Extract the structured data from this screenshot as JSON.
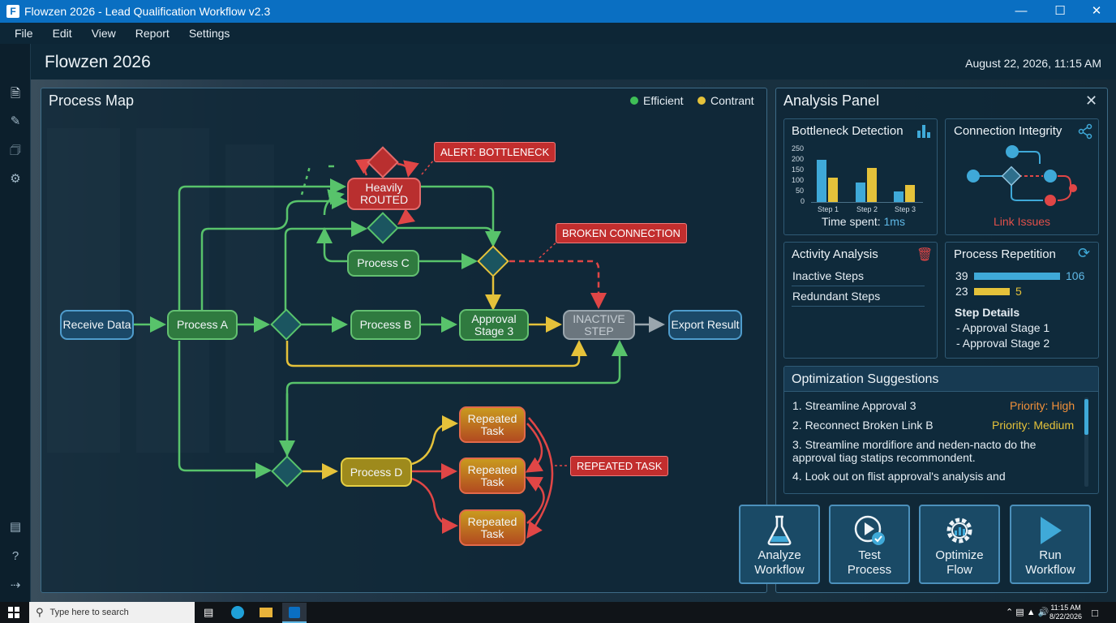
{
  "window": {
    "title": "Flowzen 2026 - Lead Qualification Workflow v2.3",
    "app_icon": "F"
  },
  "menu": [
    "File",
    "Edit",
    "View",
    "Report",
    "Settings"
  ],
  "header": {
    "title": "Flowzen 2026",
    "datetime": "August 22, 2026, 11:15 AM"
  },
  "process_map": {
    "title": "Process Map",
    "legend": [
      {
        "label": "Efficient",
        "color": "#3fbf57"
      },
      {
        "label": "Contrant",
        "color": "#e5c23a"
      }
    ],
    "nodes": {
      "receive": "Receive Data",
      "proc_a": "Process A",
      "proc_b": "Process B",
      "proc_c": "Process C",
      "proc_d": "Process D",
      "approval_1": "Approval",
      "approval_2": "Stage 3",
      "inactive_1": "INACTIVE",
      "inactive_2": "STEP",
      "export": "Export Result",
      "heavy_1": "Heavily",
      "heavy_2": "ROUTED",
      "rep_line1": "Repeated",
      "rep_line2": "Task"
    },
    "alerts": {
      "bottleneck": "ALERT: BOTTLENECK",
      "broken": "BROKEN CONNECTION",
      "repeated": "REPEATED TASK"
    }
  },
  "analysis": {
    "title": "Analysis Panel",
    "bottleneck": {
      "title": "Bottleneck Detection",
      "y_ticks": [
        "250",
        "200",
        "150",
        "100",
        "50",
        "0"
      ],
      "steps": [
        "Step 1",
        "Step 2",
        "Step 3"
      ],
      "footer_label": "Time spent: ",
      "footer_value": "1ms"
    },
    "connection": {
      "title": "Connection Integrity",
      "footer": "Link Issues"
    },
    "activity": {
      "title": "Activity Analysis",
      "items": [
        "Inactive Steps",
        "Redundant Steps"
      ]
    },
    "repetition": {
      "title": "Process Repetition",
      "rows": [
        {
          "left": "39",
          "right": "106",
          "color": "#3fa9d8",
          "fraction": 1.0
        },
        {
          "left": "23",
          "right": "5",
          "color": "#e5c23a",
          "fraction": 0.41
        }
      ],
      "details_title": "Step Details",
      "details": [
        "- Approval Stage 1",
        "- Approval Stage 2"
      ]
    },
    "suggestions": {
      "title": "Optimization Suggestions",
      "items": [
        {
          "text": "1. Streamline Approval 3",
          "priority": "Priority: High"
        },
        {
          "text": "2. Reconnect Broken Link B",
          "priority": "Priority: Medium"
        },
        {
          "text": "3. Streamline mordifiore and neden-nacto do the approval tiag statips recommondent.",
          "priority": ""
        },
        {
          "text": "4. Look out on flist approval's analysis and",
          "priority": ""
        }
      ]
    }
  },
  "actions": [
    {
      "line1": "Analyze",
      "line2": "Workflow",
      "icon": "flask-icon"
    },
    {
      "line1": "Test",
      "line2": "Process",
      "icon": "play-check-icon"
    },
    {
      "line1": "Optimize",
      "line2": "Flow",
      "icon": "gear-chart-icon"
    },
    {
      "line1": "Run",
      "line2": "Workflow",
      "icon": "play-icon"
    }
  ],
  "taskbar": {
    "search_placeholder": "Type here to search",
    "time": "11:15 AM",
    "date": "8/22/2026"
  }
}
